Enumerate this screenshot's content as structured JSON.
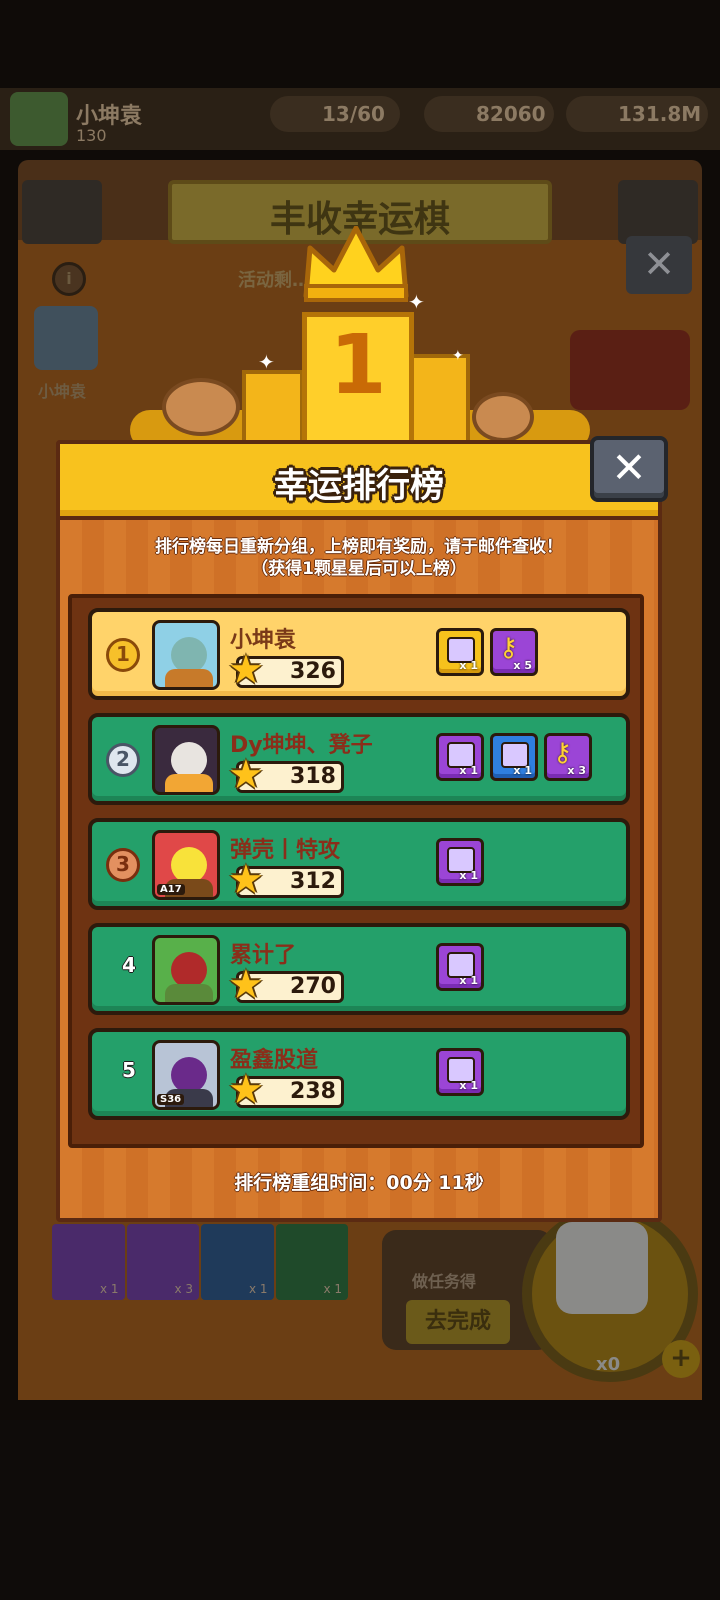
{
  "background": {
    "player_name": "小坤袁",
    "player_level": "130",
    "resource_1": "13/60",
    "resource_2": "82060",
    "resource_3": "131.8M",
    "event_title": "丰收幸运棋",
    "event_timer": "活动剩… 分 11秒",
    "sidebar_player_name": "小坤袁",
    "items": [
      {
        "qty": "x 1",
        "color": "#4a2a6a"
      },
      {
        "qty": "x 3",
        "color": "#4a2a6a"
      },
      {
        "qty": "x 1",
        "color": "#1f3a5a"
      },
      {
        "qty": "x 1",
        "color": "#1f4a2a"
      }
    ],
    "task_label": "做任务得",
    "task_button": "去完成",
    "dice_count": "x0",
    "plus_label": "+",
    "info_label": "i"
  },
  "podium": {
    "number": "1"
  },
  "modal": {
    "title": "幸运排行榜",
    "close_label": "✕",
    "notice_line1": "排行榜每日重新分组，上榜即有奖励，请于邮件查收！",
    "notice_line2": "（获得1颗星星后可以上榜）",
    "footer": "排行榜重组时间：00分 11秒"
  },
  "leaderboard": [
    {
      "rank": "1",
      "name": "小坤袁",
      "score": "326",
      "rewards": [
        {
          "type": "chest",
          "color": "gold",
          "qty": "x 1"
        },
        {
          "type": "key",
          "color": "purple",
          "qty": "x 5"
        }
      ]
    },
    {
      "rank": "2",
      "name": "Dy坤坤、凳子",
      "score": "318",
      "rewards": [
        {
          "type": "chest",
          "color": "purple",
          "qty": "x 1"
        },
        {
          "type": "chest",
          "color": "blue",
          "qty": "x 1"
        },
        {
          "type": "key",
          "color": "purple",
          "qty": "x 3"
        }
      ]
    },
    {
      "rank": "3",
      "name": "弹壳丨特攻",
      "score": "312",
      "rewards": [
        {
          "type": "chest",
          "color": "purple",
          "qty": "x 1"
        }
      ]
    },
    {
      "rank": "4",
      "name": "累计了",
      "score": "270",
      "rewards": [
        {
          "type": "chest",
          "color": "purple",
          "qty": "x 1"
        }
      ]
    },
    {
      "rank": "5",
      "name": "盈鑫股道",
      "score": "238",
      "rewards": [
        {
          "type": "chest",
          "color": "purple",
          "qty": "x 1"
        }
      ]
    }
  ],
  "avatars": [
    {
      "bg": "#8fd0e6",
      "head": "#7fb5b0",
      "body": "#c77a2a",
      "badge": ""
    },
    {
      "bg": "#3a2a3e",
      "head": "#e8e4e0",
      "body": "#f2a634",
      "badge": ""
    },
    {
      "bg": "#e04848",
      "head": "#f8e23a",
      "body": "#7a4a1a",
      "badge": "A17"
    },
    {
      "bg": "#58b04a",
      "head": "#b02a2a",
      "body": "#5a8a3a",
      "badge": ""
    },
    {
      "bg": "#b8c4d6",
      "head": "#6a2a8a",
      "body": "#3a3a4a",
      "badge": "S36"
    }
  ],
  "medal_colors": {
    "1": {
      "bg": "#f7c02a",
      "border": "#8a4a0a",
      "text": "#8a4a0a"
    },
    "2": {
      "bg": "#dfe6ee",
      "border": "#4a5566",
      "text": "#4a5566"
    },
    "3": {
      "bg": "#e39060",
      "border": "#7a2e0e",
      "text": "#7a2e0e"
    }
  }
}
